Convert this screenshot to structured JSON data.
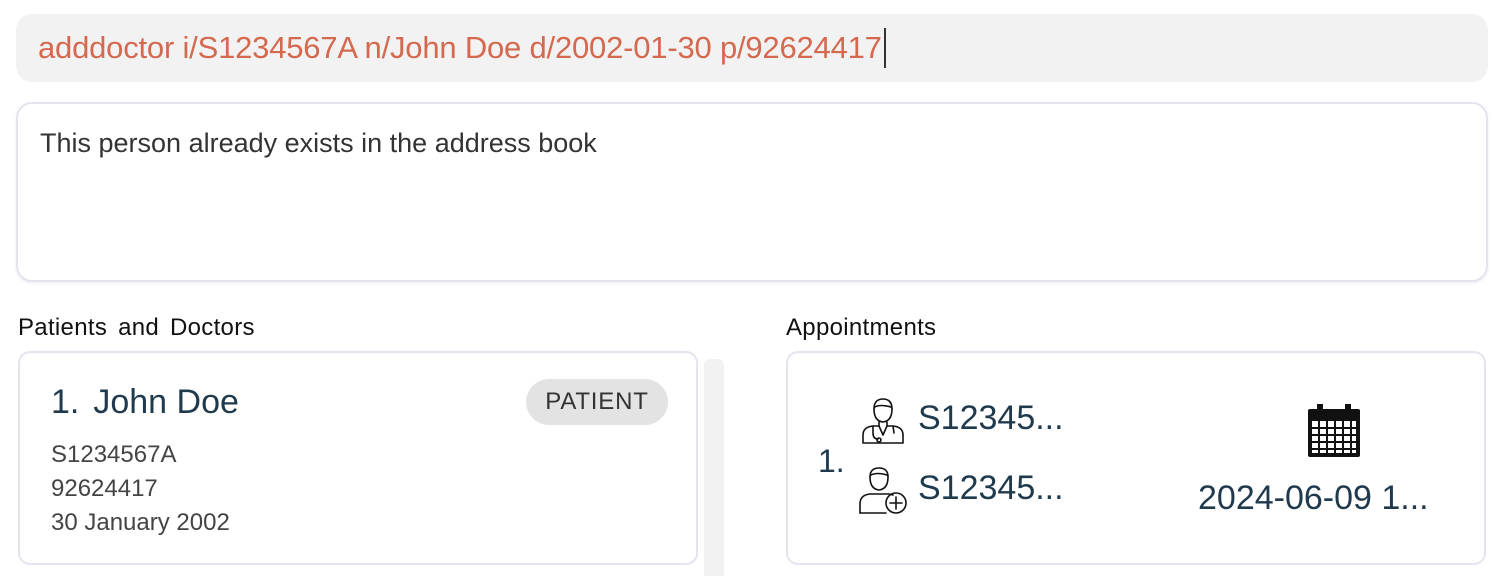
{
  "command": {
    "text": "adddoctor i/S1234567A n/John Doe d/2002-01-30 p/92624417"
  },
  "result": {
    "message": "This person already exists in the address book"
  },
  "person_list": {
    "label": "Patients and Doctors",
    "items": [
      {
        "index": "1.",
        "name": "John Doe",
        "tag": "PATIENT",
        "nric": "S1234567A",
        "phone": "92624417",
        "dob": "30 January 2002"
      }
    ]
  },
  "appointment_list": {
    "label": "Appointments",
    "items": [
      {
        "index": "1.",
        "doctor_id": "S12345...",
        "patient_id": "S12345...",
        "datetime": "2024-06-09 1..."
      }
    ]
  },
  "icons": {
    "doctor": "doctor-icon",
    "patient": "patient-icon",
    "calendar": "calendar-icon"
  },
  "colors": {
    "command_text": "#d4694f",
    "heading_text": "#1f3a4d",
    "tag_background": "#e3e3e3"
  }
}
